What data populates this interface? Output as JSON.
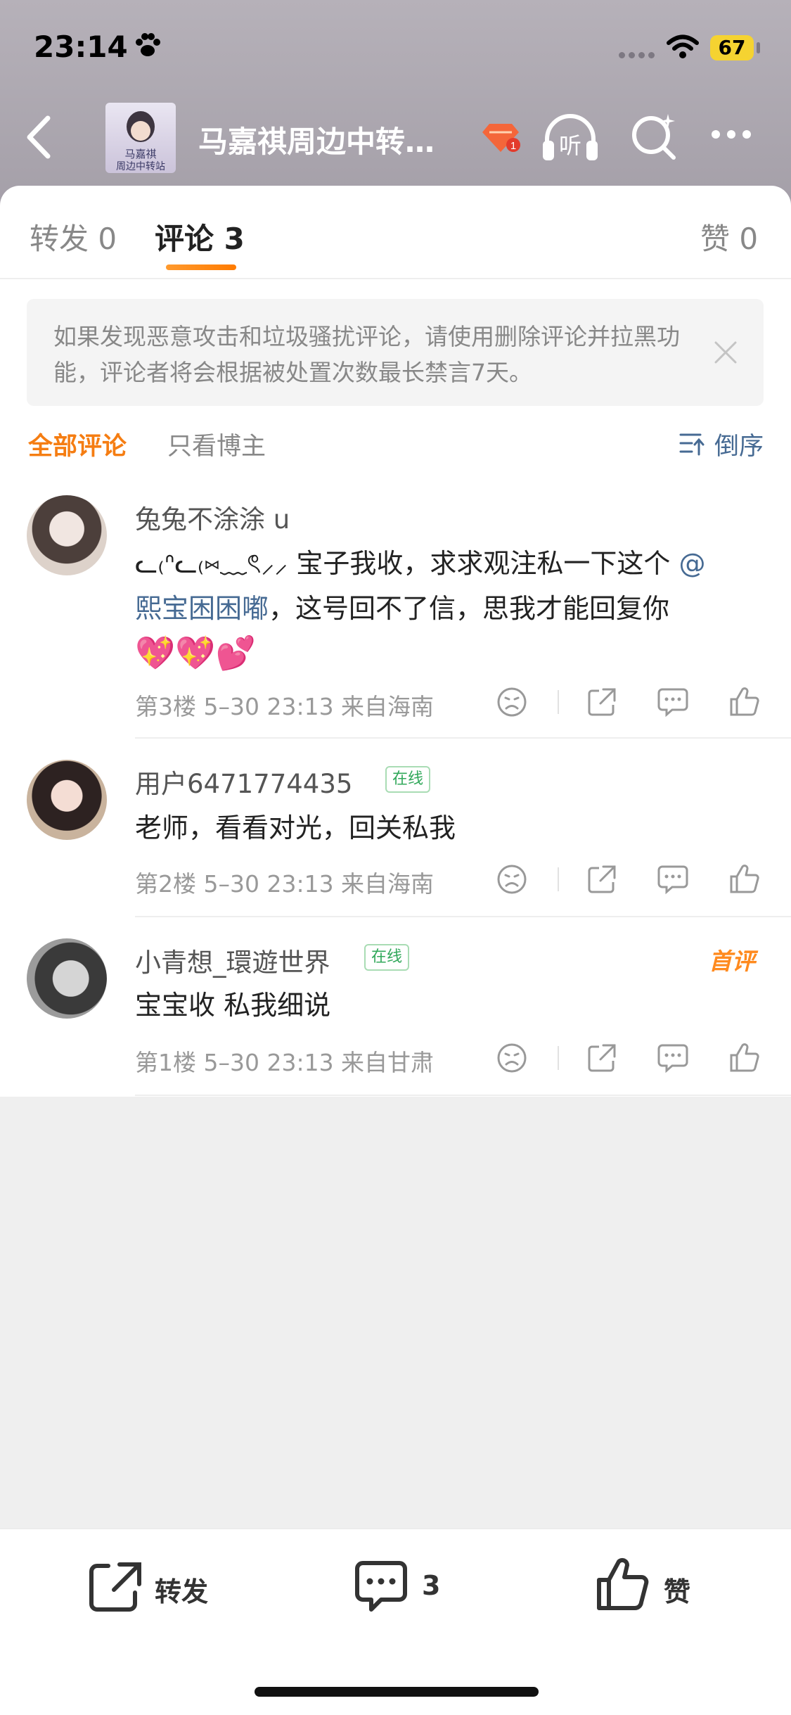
{
  "status_bar": {
    "time": "23:14",
    "battery": "67"
  },
  "header": {
    "title": "马嘉祺周边中转…",
    "avatar_line1": "马嘉祺",
    "avatar_line2": "周边中转站"
  },
  "tabs": {
    "reposts": "转发 0",
    "comments": "评论 3",
    "likes": "赞 0"
  },
  "notice": {
    "text": "如果发现恶意攻击和垃圾骚扰评论，请使用删除评论并拉黑功能，评论者将会根据被处置次数最长禁言7天。"
  },
  "filters": {
    "all": "全部评论",
    "host_only": "只看博主",
    "sort": "倒序"
  },
  "comments": [
    {
      "user": "兔兔不涂涂 u",
      "text_prefix": "ᓚ₍ᐢᓚ₍⑅﹏ৎ⸝⸝ 宝子我收，求求观注私一下这个",
      "mention_part1": "@",
      "mention_part2": "熙宝困困嘟",
      "text_line2_rest": "，这号回不了信，思我才能回复你",
      "emoji": "💖💖💕",
      "meta": "第3楼 5–30 23:13  来自海南"
    },
    {
      "user": "用户6471774435",
      "online": "在线",
      "text": "老师，看看对光，回关私我",
      "meta": "第2楼 5–30 23:13  来自海南"
    },
    {
      "user": "小青想_環遊世界",
      "online": "在线",
      "tag": "首评",
      "text": "宝宝收 私我细说",
      "meta": "第1楼 5–30 23:13  来自甘肃"
    }
  ],
  "bottom_bar": {
    "repost": "转发",
    "comment_count": "3",
    "like": "赞"
  },
  "colors": {
    "accent": "#f57d12",
    "link": "#466a93",
    "online": "#31a85a"
  }
}
